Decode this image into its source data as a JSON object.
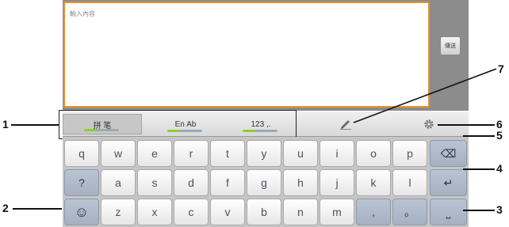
{
  "input": {
    "placeholder": "輸入內容",
    "send_label": "傳送"
  },
  "mode_bar": {
    "tabs": [
      {
        "label": "拼 笔",
        "active": true
      },
      {
        "label": "En Ab",
        "active": false
      },
      {
        "label": "123 ,.",
        "active": false
      }
    ],
    "handwriting_icon": "pen-icon",
    "settings_icon": "gear-icon"
  },
  "keyboard": {
    "row1": [
      "q",
      "w",
      "e",
      "r",
      "t",
      "y",
      "u",
      "i",
      "o",
      "p"
    ],
    "row1_end": {
      "label": "⌫",
      "icon": "delete-icon"
    },
    "row2_start": "?",
    "row2": [
      "a",
      "s",
      "d",
      "f",
      "g",
      "h",
      "j",
      "k",
      "l"
    ],
    "row2_end": {
      "label": "↵",
      "icon": "enter-icon"
    },
    "row3_start": {
      "label": "☺",
      "icon": "emoticon-icon"
    },
    "row3": [
      "z",
      "x",
      "c",
      "v",
      "b",
      "n",
      "m"
    ],
    "punct": [
      ",",
      "。"
    ],
    "space": {
      "label": "⎵",
      "icon": "space-icon"
    }
  },
  "callouts": [
    "1",
    "2",
    "3",
    "4",
    "5",
    "6",
    "7"
  ],
  "colors": {
    "input_border": "#e7922a",
    "mode_indicator": "#8ccf2a",
    "function_key": "#a5b1c2",
    "letter_key": "#f2f2f2"
  }
}
